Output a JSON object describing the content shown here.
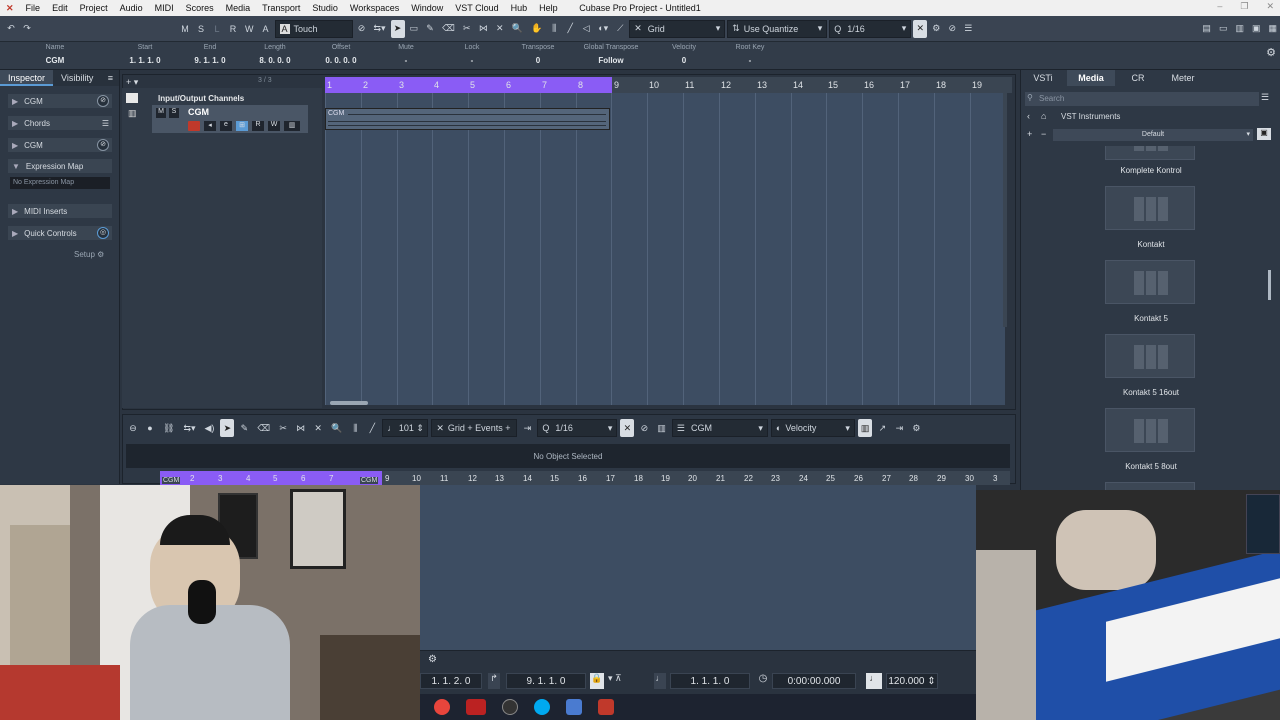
{
  "menubar": {
    "items": [
      "File",
      "Edit",
      "Project",
      "Audio",
      "MIDI",
      "Scores",
      "Media",
      "Transport",
      "Studio",
      "Workspaces",
      "Window",
      "VST Cloud",
      "Hub",
      "Help"
    ],
    "title": "Cubase Pro Project - Untitled1"
  },
  "toolbar": {
    "mode_buttons": [
      "M",
      "S",
      "L",
      "R",
      "W",
      "A"
    ],
    "automation_mode": "Touch",
    "snap_type": "Grid",
    "quantize_mode": "Use Quantize",
    "quantize_value": "1/16"
  },
  "infoline": {
    "columns": [
      {
        "label": "Name",
        "value": "CGM"
      },
      {
        "label": "Start",
        "value": "1. 1. 1.   0"
      },
      {
        "label": "End",
        "value": "9. 1. 1.   0"
      },
      {
        "label": "Length",
        "value": "8. 0. 0.   0"
      },
      {
        "label": "Offset",
        "value": "0. 0. 0.   0"
      },
      {
        "label": "Mute",
        "value": "-"
      },
      {
        "label": "Lock",
        "value": "-"
      },
      {
        "label": "Transpose",
        "value": "0"
      },
      {
        "label": "Global Transpose",
        "value": "Follow"
      },
      {
        "label": "Velocity",
        "value": "0"
      },
      {
        "label": "Root Key",
        "value": "-"
      }
    ]
  },
  "inspector": {
    "tabs": [
      "Inspector",
      "Visibility"
    ],
    "track_name": "CGM",
    "sections": [
      "Chords",
      "CGM",
      "Expression Map",
      "MIDI Inserts",
      "Quick Controls"
    ],
    "no_expression_map": "No Expression Map",
    "setup": "Setup"
  },
  "tracklist": {
    "folder": "Input/Output Channels",
    "track": "CGM",
    "count": "3 / 3"
  },
  "ruler": {
    "bars": [
      "1",
      "2",
      "3",
      "4",
      "5",
      "6",
      "7",
      "8",
      "9",
      "10",
      "11",
      "12",
      "13",
      "14",
      "15",
      "16",
      "17",
      "18",
      "19"
    ]
  },
  "event": {
    "name": "CGM"
  },
  "lowerzone": {
    "grid_mode": "Grid + Events +",
    "quantize": "1/16",
    "value": "101",
    "track": "CGM",
    "controller": "Velocity",
    "status": "No Object Selected",
    "bars": [
      "1",
      "2",
      "3",
      "4",
      "5",
      "6",
      "7",
      "8",
      "9",
      "10",
      "11",
      "12",
      "13",
      "14",
      "15",
      "16",
      "17",
      "18",
      "19",
      "20",
      "21",
      "22",
      "23",
      "24",
      "25",
      "26",
      "27",
      "28",
      "29",
      "30",
      "3"
    ],
    "cgm_left": "CGM",
    "cgm_right": "CGM"
  },
  "mediabay": {
    "tabs": [
      "VSTi",
      "Media",
      "CR",
      "Meter"
    ],
    "search_placeholder": "Search",
    "breadcrumb": "VST Instruments",
    "preset": "Default",
    "instruments": [
      "Komplete Kontrol",
      "Kontakt",
      "Kontakt 5",
      "Kontakt 5 16out",
      "Kontakt 5 8out"
    ]
  },
  "transport": {
    "left_locator": "1. 1. 2.   0",
    "right_locator": "9. 1. 1.   0",
    "position": "1. 1. 1.   0",
    "time": "0:00:00.000",
    "tempo": "120.000"
  },
  "colors": {
    "cycle": "#8a5cf5",
    "accent": "#5b9bd5"
  }
}
